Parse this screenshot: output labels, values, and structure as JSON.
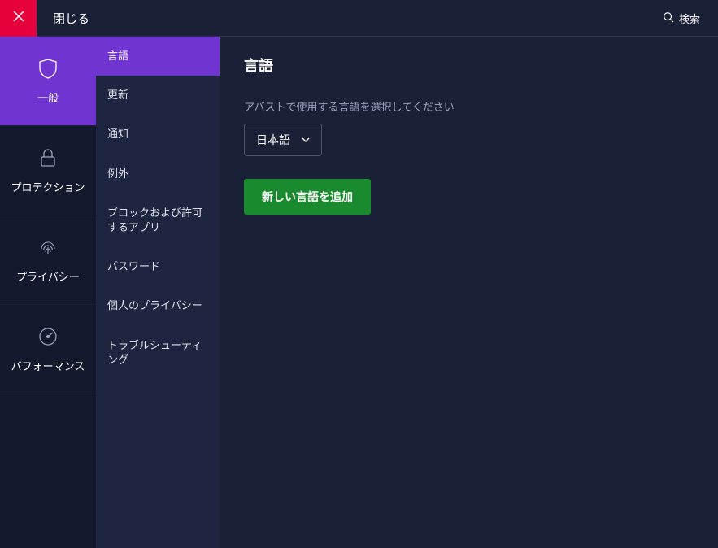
{
  "header": {
    "close_label": "閉じる",
    "search_label": "検索"
  },
  "left_nav": {
    "items": [
      {
        "label": "一般"
      },
      {
        "label": "プロテクション"
      },
      {
        "label": "プライバシー"
      },
      {
        "label": "パフォーマンス"
      }
    ]
  },
  "sub_nav": {
    "items": [
      {
        "label": "言語"
      },
      {
        "label": "更新"
      },
      {
        "label": "通知"
      },
      {
        "label": "例外"
      },
      {
        "label": "ブロックおよび許可するアプリ"
      },
      {
        "label": "パスワード"
      },
      {
        "label": "個人のプライバシー"
      },
      {
        "label": "トラブルシューティング"
      }
    ]
  },
  "main": {
    "title": "言語",
    "description": "アバストで使用する言語を選択してください",
    "selected_language": "日本語",
    "add_button_label": "新しい言語を追加"
  }
}
